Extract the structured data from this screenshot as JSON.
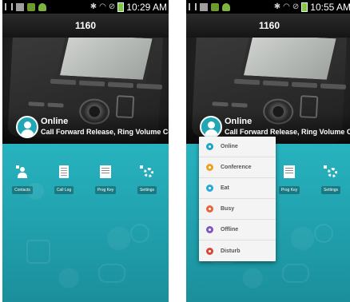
{
  "screens": [
    {
      "statusbar": {
        "time": "10:29 AM"
      },
      "title": "1160",
      "presence": {
        "name": "Online",
        "subtitle": "Call Forward Release, Ring Volume Control"
      },
      "apps": [
        {
          "label": "Contacts",
          "icon": "contacts-icon"
        },
        {
          "label": "Call Log",
          "icon": "call-log-icon"
        },
        {
          "label": "Prog Key",
          "icon": "prog-key-icon"
        },
        {
          "label": "Settings",
          "icon": "settings-icon"
        }
      ]
    },
    {
      "statusbar": {
        "time": "10:55 AM"
      },
      "title": "1160",
      "presence": {
        "name": "Online",
        "subtitle": "Call Forward Release, Ring Volume Control"
      },
      "apps": [
        {
          "label": "Prog Key",
          "icon": "prog-key-icon"
        },
        {
          "label": "Settings",
          "icon": "settings-icon"
        }
      ],
      "status_menu": [
        {
          "label": "Online",
          "color": "#1aa6c4"
        },
        {
          "label": "Conference",
          "color": "#f0a020"
        },
        {
          "label": "Eat",
          "color": "#29a9d8"
        },
        {
          "label": "Busy",
          "color": "#e8643c"
        },
        {
          "label": "Offline",
          "color": "#7e57c2"
        },
        {
          "label": "Disturb",
          "color": "#d9473a"
        }
      ]
    }
  ]
}
